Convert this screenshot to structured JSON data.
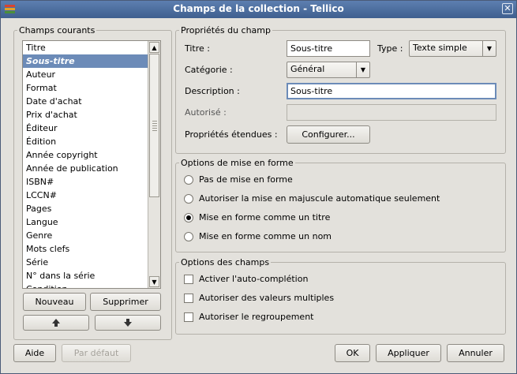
{
  "window": {
    "title": "Champs de la collection - Tellico",
    "close_glyph": "✕"
  },
  "current_fields": {
    "legend": "Champs courants",
    "items": [
      "Titre",
      "Sous-titre",
      "Auteur",
      "Format",
      "Date d'achat",
      "Prix d'achat",
      "Éditeur",
      "Édition",
      "Année copyright",
      "Année de publication",
      "ISBN#",
      "LCCN#",
      "Pages",
      "Langue",
      "Genre",
      "Mots clefs",
      "Série",
      "N° dans la série",
      "Condition"
    ],
    "selected_index": 1,
    "new_button": "Nouveau",
    "delete_button": "Supprimer",
    "up_icon": "arrow-up-icon",
    "down_icon": "arrow-down-icon"
  },
  "field_properties": {
    "legend": "Propriétés du champ",
    "title_label": "Titre :",
    "title_value": "Sous-titre",
    "type_label": "Type :",
    "type_value": "Texte simple",
    "category_label": "Catégorie :",
    "category_value": "Général",
    "description_label": "Description :",
    "description_value": "Sous-titre",
    "allowed_label": "Autorisé :",
    "allowed_value": "",
    "extended_label": "Propriétés étendues :",
    "configure_button": "Configurer..."
  },
  "format_options": {
    "legend": "Options de mise en forme",
    "options": [
      "Pas de mise en forme",
      "Autoriser la mise en majuscule automatique seulement",
      "Mise en forme comme un titre",
      "Mise en forme comme un nom"
    ],
    "selected_index": 2
  },
  "field_options": {
    "legend": "Options des champs",
    "options": [
      "Activer l'auto-complétion",
      "Autoriser des valeurs multiples",
      "Autoriser le regroupement"
    ],
    "checked": [
      false,
      false,
      false
    ]
  },
  "footer": {
    "help": "Aide",
    "default": "Par défaut",
    "ok": "OK",
    "apply": "Appliquer",
    "cancel": "Annuler"
  }
}
